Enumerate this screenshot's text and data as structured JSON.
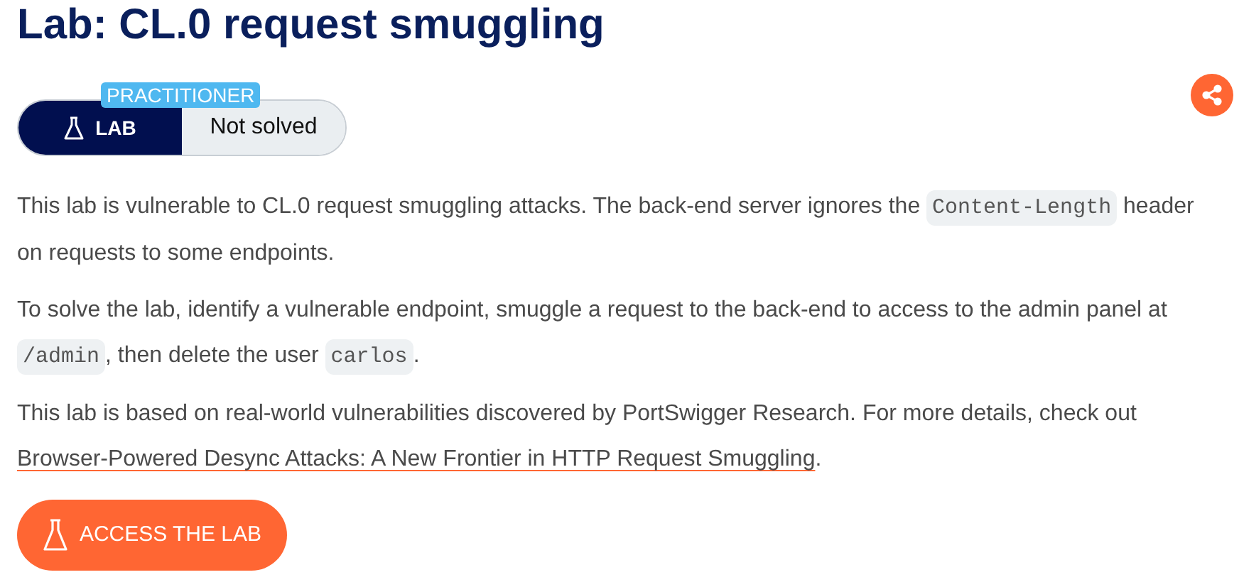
{
  "title": "Lab: CL.0 request smuggling",
  "level_badge": "PRACTITIONER",
  "lab_tag": "LAB",
  "status": {
    "label": "Not solved",
    "solved": false
  },
  "paragraphs": [
    [
      {
        "kind": "text",
        "text": "This lab is vulnerable to CL.0 request smuggling attacks. The back-end server ignores the "
      },
      {
        "kind": "code",
        "text": "Content-Length"
      },
      {
        "kind": "text",
        "text": " header on requests to some endpoints."
      }
    ],
    [
      {
        "kind": "text",
        "text": "To solve the lab, identify a vulnerable endpoint, smuggle a request to the back-end to access to the admin panel at "
      },
      {
        "kind": "code",
        "text": "/admin"
      },
      {
        "kind": "text",
        "text": ", then delete the user "
      },
      {
        "kind": "code",
        "text": "carlos"
      },
      {
        "kind": "text",
        "text": "."
      }
    ],
    [
      {
        "kind": "text",
        "text": "This lab is based on real-world vulnerabilities discovered by PortSwigger Research. For more details, check out "
      },
      {
        "kind": "link",
        "text": "Browser-Powered Desync Attacks: A New Frontier in HTTP Request Smuggling"
      },
      {
        "kind": "text",
        "text": "."
      }
    ]
  ],
  "access_button": "ACCESS THE LAB"
}
